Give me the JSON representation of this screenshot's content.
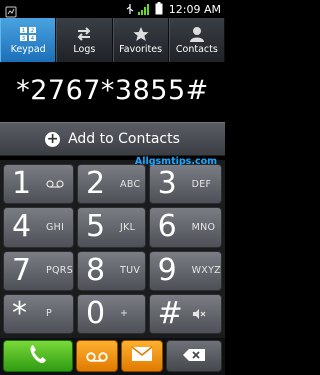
{
  "status_bar": {
    "time": "12:09 AM"
  },
  "tabs": [
    {
      "label": "Keypad",
      "icon": "keypad-icon",
      "active": true
    },
    {
      "label": "Logs",
      "icon": "logs-icon",
      "active": false
    },
    {
      "label": "Favorites",
      "icon": "star-icon",
      "active": false
    },
    {
      "label": "Contacts",
      "icon": "contacts-icon",
      "active": false
    }
  ],
  "display": {
    "number": "*2767*3855#"
  },
  "add_contacts": {
    "label": "Add to Contacts"
  },
  "watermark": "Allgsmtips.com",
  "keypad": [
    {
      "main": "1",
      "sub": ""
    },
    {
      "main": "2",
      "sub": "ABC"
    },
    {
      "main": "3",
      "sub": "DEF"
    },
    {
      "main": "4",
      "sub": "GHI"
    },
    {
      "main": "5",
      "sub": "JKL"
    },
    {
      "main": "6",
      "sub": "MNO"
    },
    {
      "main": "7",
      "sub": "PQRS"
    },
    {
      "main": "8",
      "sub": "TUV"
    },
    {
      "main": "9",
      "sub": "WXYZ"
    },
    {
      "main": "*",
      "sub": "P"
    },
    {
      "main": "0",
      "sub": "+"
    },
    {
      "main": "#",
      "sub": ""
    }
  ],
  "colors": {
    "accent_blue": "#1b6fb8",
    "call_green": "#2f9c12",
    "orange": "#e07a00",
    "watermark": "#1ea6ff"
  }
}
